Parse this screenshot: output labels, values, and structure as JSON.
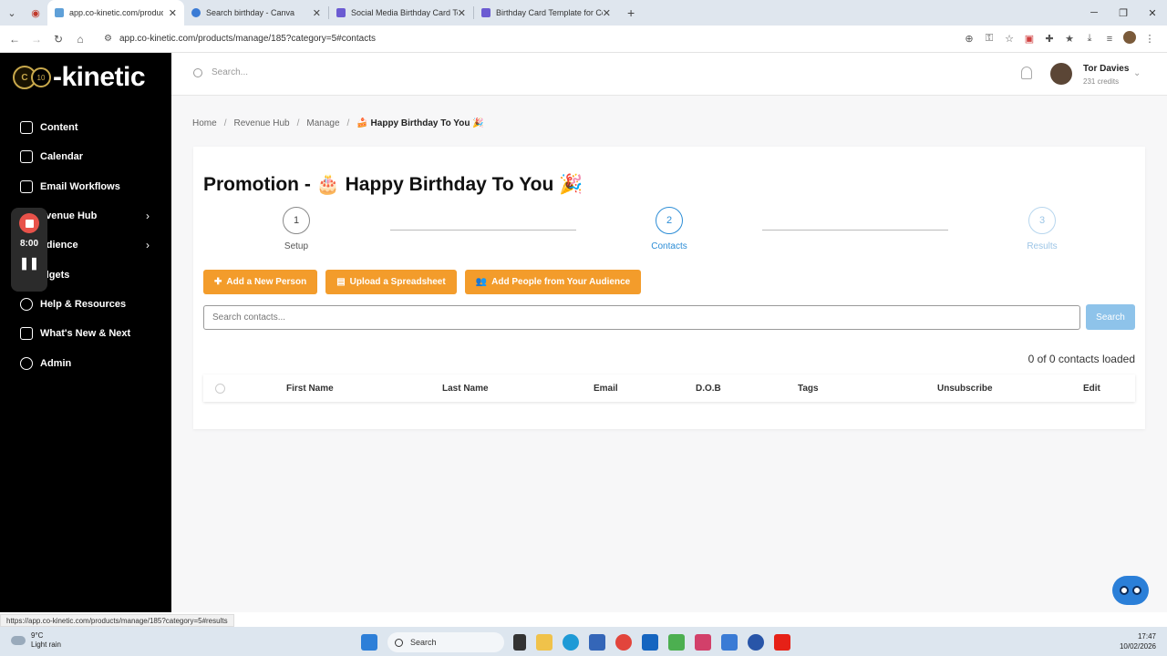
{
  "browser": {
    "tabs": [
      {
        "title": "app.co-kinetic.com/products/m",
        "active": true
      },
      {
        "title": "Search birthday - Canva",
        "active": false
      },
      {
        "title": "Social Media Birthday Card Ten",
        "active": false
      },
      {
        "title": "Birthday Card Template for Co",
        "active": false
      }
    ],
    "url": "app.co-kinetic.com/products/manage/185?category=5#contacts",
    "status_url": "https://app.co-kinetic.com/products/manage/185?category=5#results"
  },
  "sidebar": {
    "logo_text": "-kinetic",
    "logo_badge": "10",
    "items": [
      {
        "label": "Content",
        "icon": "content-icon"
      },
      {
        "label": "Calendar",
        "icon": "calendar-icon"
      },
      {
        "label": "Email Workflows",
        "icon": "mail-icon"
      },
      {
        "label": "evenue Hub",
        "icon": "revenue-icon",
        "chevron": true
      },
      {
        "label": "udience",
        "icon": "audience-icon",
        "chevron": true
      },
      {
        "label": "idgets",
        "icon": "widgets-icon"
      },
      {
        "label": "Help & Resources",
        "icon": "help-icon"
      },
      {
        "label": "What's New & Next",
        "icon": "sparkle-icon"
      },
      {
        "label": "Admin",
        "icon": "gear-icon"
      }
    ]
  },
  "recorder": {
    "time": "8:00"
  },
  "header": {
    "search_placeholder": "Search...",
    "user_name": "Tor Davies",
    "credits": "231 credits"
  },
  "breadcrumb": {
    "items": [
      "Home",
      "Revenue Hub",
      "Manage"
    ],
    "current": "🍰 Happy Birthday To You 🎉"
  },
  "page": {
    "title": "Promotion - 🎂 Happy Birthday To You 🎉",
    "steps": [
      {
        "num": "1",
        "label": "Setup",
        "state": "done"
      },
      {
        "num": "2",
        "label": "Contacts",
        "state": "active"
      },
      {
        "num": "3",
        "label": "Results",
        "state": "upcoming"
      }
    ],
    "buttons": {
      "add_person": "Add a New Person",
      "upload": "Upload a Spreadsheet",
      "add_audience": "Add People from Your Audience"
    },
    "search_placeholder": "Search contacts...",
    "search_button": "Search",
    "loaded_text": "0 of 0 contacts loaded",
    "columns": [
      "First Name",
      "Last Name",
      "Email",
      "D.O.B",
      "Tags",
      "Unsubscribe",
      "Edit"
    ]
  },
  "taskbar": {
    "temp": "9°C",
    "weather": "Light rain",
    "search": "Search",
    "time": "17:47",
    "date": "10/02/2026"
  },
  "colors": {
    "accent_orange": "#f39c2b",
    "accent_blue": "#2c8dd6",
    "search_button": "#8ec3ea"
  }
}
